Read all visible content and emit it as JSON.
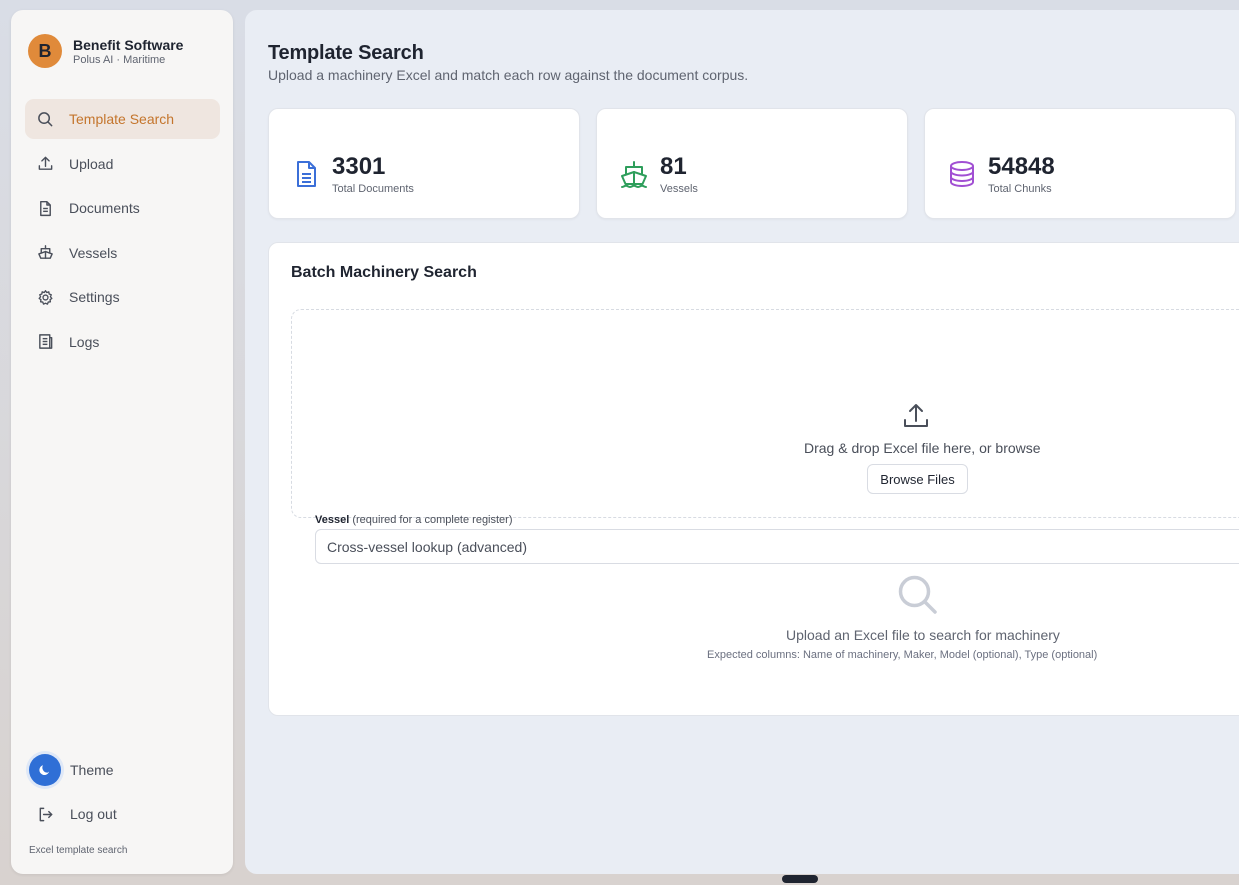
{
  "brand": {
    "name": "Benefit Software",
    "subtitle": "Polus AI · Maritime",
    "logo_letter": "B",
    "accent": "#e08a3a"
  },
  "sidebar": {
    "items": [
      {
        "label": "Template Search",
        "icon": "search-icon",
        "active": true
      },
      {
        "label": "Upload",
        "icon": "upload-icon"
      },
      {
        "label": "Documents",
        "icon": "document-icon"
      },
      {
        "label": "Vessels",
        "icon": "ship-icon"
      },
      {
        "label": "Settings",
        "icon": "gear-icon"
      },
      {
        "label": "Logs",
        "icon": "log-icon"
      }
    ],
    "theme_label": "Theme",
    "logout_label": "Log out",
    "footer": "Excel template search"
  },
  "header": {
    "title": "Template Search",
    "subtitle": "Upload a machinery Excel and match each row against the document corpus."
  },
  "stats": [
    {
      "value": "3301",
      "label": "Total Documents",
      "icon": "document-icon",
      "color": "#3b6fd8"
    },
    {
      "value": "81",
      "label": "Vessels",
      "icon": "ship-icon",
      "color": "#2e9e5b"
    },
    {
      "value": "54848",
      "label": "Total Chunks",
      "icon": "database-icon",
      "color": "#a14fd3"
    }
  ],
  "batch": {
    "title": "Batch Machinery Search",
    "drop_text": "Drag & drop Excel file here, or browse",
    "browse_label": "Browse Files",
    "vessel_label": "Vessel",
    "vessel_hint": "(required for a complete register)",
    "vessel_placeholder": "Cross-vessel lookup (advanced)",
    "empty_title": "Upload an Excel file to search for machinery",
    "empty_sub": "Expected columns: Name of machinery, Maker, Model (optional), Type (optional)"
  }
}
